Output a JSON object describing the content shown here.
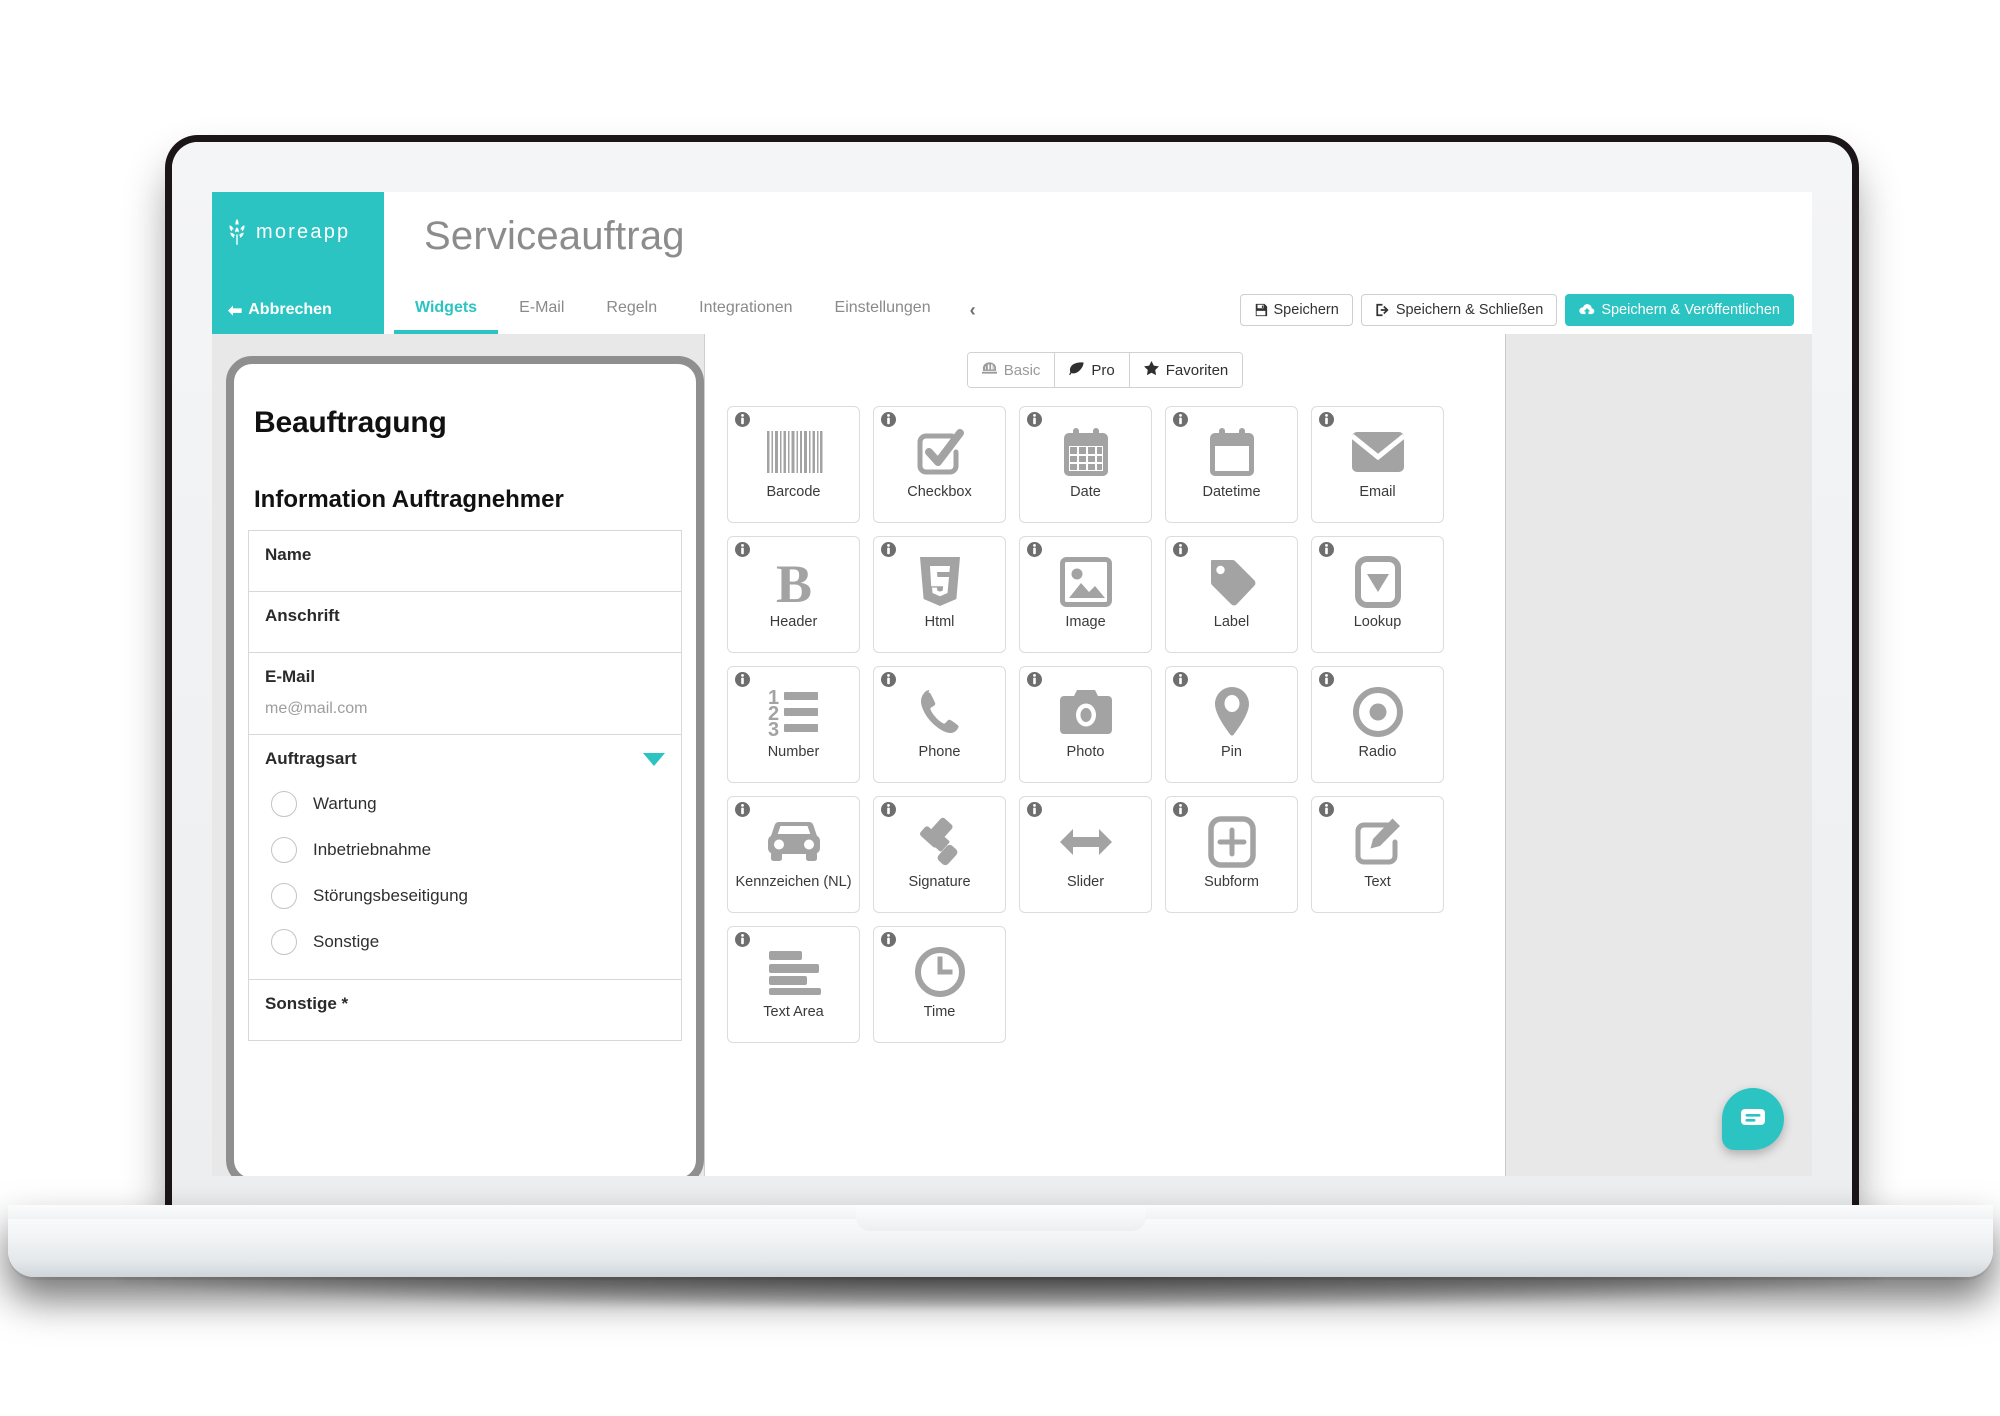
{
  "brand": {
    "wordmark": "moreapp",
    "logo_icon": "wheat-icon",
    "color": "#2bc4c2"
  },
  "header": {
    "page_title": "Serviceauftrag"
  },
  "navbar": {
    "cancel_label": "Abbrechen",
    "tabs": [
      {
        "label": "Widgets",
        "active": true
      },
      {
        "label": "E-Mail",
        "active": false
      },
      {
        "label": "Regeln",
        "active": false
      },
      {
        "label": "Integrationen",
        "active": false
      },
      {
        "label": "Einstellungen",
        "active": false
      }
    ],
    "collapse_glyph": "‹",
    "actions": [
      {
        "label": "Speichern",
        "icon": "floppy-disk-icon",
        "primary": false
      },
      {
        "label": "Speichern & Schließen",
        "icon": "sign-out-icon",
        "primary": false
      },
      {
        "label": "Speichern & Veröffentlichen",
        "icon": "cloud-upload-icon",
        "primary": true
      }
    ]
  },
  "preview": {
    "form_title": "Beauftragung",
    "section_title": "Information Auftragnehmer",
    "fields": [
      {
        "label": "Name",
        "placeholder": "",
        "type": "text"
      },
      {
        "label": "Anschrift",
        "placeholder": "",
        "type": "text"
      },
      {
        "label": "E-Mail",
        "placeholder": "me@mail.com",
        "type": "email"
      },
      {
        "label": "Auftragsart",
        "type": "radio",
        "options": [
          "Wartung",
          "Inbetriebnahme",
          "Störungsbeseitigung",
          "Sonstige"
        ]
      },
      {
        "label": "Sonstige *",
        "placeholder": "",
        "type": "text"
      }
    ]
  },
  "widget_panel": {
    "filters": [
      {
        "label": "Basic",
        "icon": "helmet-icon",
        "active": true
      },
      {
        "label": "Pro",
        "icon": "leaf-icon",
        "active": false
      },
      {
        "label": "Favoriten",
        "icon": "star-icon",
        "active": false
      }
    ],
    "widgets": [
      {
        "label": "Barcode",
        "icon": "barcode-icon"
      },
      {
        "label": "Checkbox",
        "icon": "checkbox-icon"
      },
      {
        "label": "Date",
        "icon": "calendar-icon"
      },
      {
        "label": "Datetime",
        "icon": "calendar-blank-icon"
      },
      {
        "label": "Email",
        "icon": "envelope-icon"
      },
      {
        "label": "Header",
        "icon": "bold-b-icon"
      },
      {
        "label": "Html",
        "icon": "html5-icon"
      },
      {
        "label": "Image",
        "icon": "picture-icon"
      },
      {
        "label": "Label",
        "icon": "tag-icon"
      },
      {
        "label": "Lookup",
        "icon": "lookup-dropdown-icon"
      },
      {
        "label": "Number",
        "icon": "numbered-list-icon"
      },
      {
        "label": "Phone",
        "icon": "phone-icon"
      },
      {
        "label": "Photo",
        "icon": "camera-icon"
      },
      {
        "label": "Pin",
        "icon": "map-pin-icon"
      },
      {
        "label": "Radio",
        "icon": "radio-target-icon"
      },
      {
        "label": "Kennzeichen (NL)",
        "icon": "car-icon"
      },
      {
        "label": "Signature",
        "icon": "gavel-icon"
      },
      {
        "label": "Slider",
        "icon": "arrows-horizontal-icon"
      },
      {
        "label": "Subform",
        "icon": "plus-square-icon"
      },
      {
        "label": "Text",
        "icon": "pencil-square-icon"
      },
      {
        "label": "Text Area",
        "icon": "text-lines-icon"
      },
      {
        "label": "Time",
        "icon": "clock-icon"
      }
    ],
    "info_icon": "info-circle-icon"
  },
  "chat": {
    "icon": "chat-message-icon",
    "color": "#2bc4c2"
  }
}
